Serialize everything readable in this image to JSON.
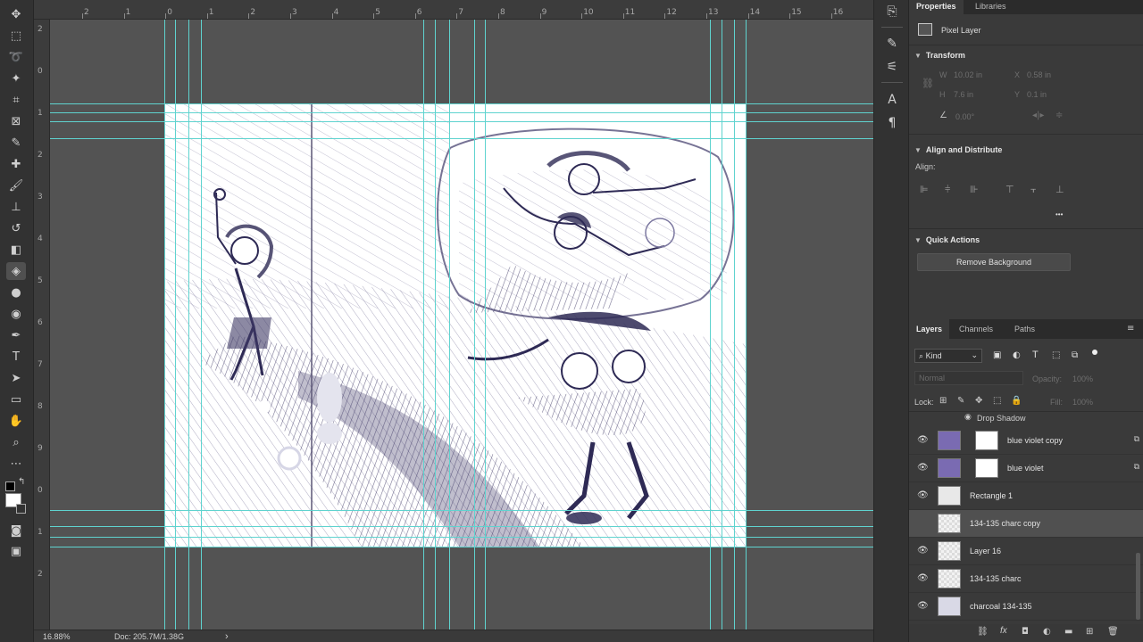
{
  "toolbar": {
    "tools": [
      {
        "icon": "move-icon",
        "glyph": "✥"
      },
      {
        "icon": "marquee-icon",
        "glyph": "⬚"
      },
      {
        "icon": "lasso-icon",
        "glyph": "➰"
      },
      {
        "icon": "magic-wand-icon",
        "glyph": "✦"
      },
      {
        "icon": "crop-icon",
        "glyph": "⌗"
      },
      {
        "icon": "frame-icon",
        "glyph": "⊠"
      },
      {
        "icon": "eyedropper-icon",
        "glyph": "✎"
      },
      {
        "icon": "healing-brush-icon",
        "glyph": "✚"
      },
      {
        "icon": "brush-icon",
        "glyph": "🖌"
      },
      {
        "icon": "clone-stamp-icon",
        "glyph": "⊥"
      },
      {
        "icon": "history-brush-icon",
        "glyph": "↺"
      },
      {
        "icon": "eraser-icon",
        "glyph": "◧"
      },
      {
        "icon": "paint-bucket-icon",
        "glyph": "◈"
      },
      {
        "icon": "blur-icon",
        "glyph": "●"
      },
      {
        "icon": "dodge-icon",
        "glyph": "◉"
      },
      {
        "icon": "pen-icon",
        "glyph": "✒"
      },
      {
        "icon": "type-icon",
        "glyph": "T"
      },
      {
        "icon": "path-selection-icon",
        "glyph": "➤"
      },
      {
        "icon": "rectangle-icon",
        "glyph": "▭"
      },
      {
        "icon": "hand-icon",
        "glyph": "✋"
      },
      {
        "icon": "zoom-icon",
        "glyph": "⌕"
      },
      {
        "icon": "more-tools-icon",
        "glyph": "⋯"
      }
    ],
    "foreground_color": "#000000",
    "background_color": "#ffffff"
  },
  "rulers": {
    "top": [
      "2",
      "1",
      "0",
      "1",
      "2",
      "3",
      "4",
      "5",
      "6",
      "7",
      "8",
      "9",
      "10",
      "11",
      "12",
      "13",
      "14",
      "15",
      "16"
    ],
    "left": [
      "2",
      "0",
      "1",
      "2",
      "3",
      "4",
      "5",
      "6",
      "7",
      "8",
      "9",
      "0",
      "1",
      "2"
    ]
  },
  "status": {
    "zoom": "16.88%",
    "doc_info": "Doc: 205.7M/1.38G",
    "arrow": "›"
  },
  "mid_icons": [
    "history-icon",
    "brush-settings-icon",
    "adjustments-icon",
    "character-icon",
    "paragraph-icon"
  ],
  "properties": {
    "tabs": [
      "Properties",
      "Libraries"
    ],
    "layer_type": "Pixel Layer",
    "transform_heading": "Transform",
    "w_label": "W",
    "w_value": "10.02 in",
    "x_label": "X",
    "x_value": "0.58 in",
    "h_label": "H",
    "h_value": "7.6 in",
    "y_label": "Y",
    "y_value": "0.1 in",
    "angle_value": "0.00°",
    "align_heading": "Align and Distribute",
    "align_label": "Align:",
    "more": "•••",
    "quick_actions_heading": "Quick Actions",
    "remove_bg": "Remove Background"
  },
  "layers_panel": {
    "tabs": [
      "Layers",
      "Channels",
      "Paths"
    ],
    "filter_kind": "Kind",
    "blend_mode": "Normal",
    "opacity_label": "Opacity:",
    "opacity_value": "100%",
    "lock_label": "Lock:",
    "fill_label": "Fill:",
    "fill_value": "100%",
    "drop_shadow": "Drop Shadow",
    "layers": [
      {
        "name": "blue violet copy",
        "visible": true,
        "thumb_color": "#7a6bb2",
        "mask": true,
        "selected": false
      },
      {
        "name": "blue violet",
        "visible": true,
        "thumb_color": "#7a6bb2",
        "mask": true,
        "selected": false
      },
      {
        "name": "Rectangle 1",
        "visible": true,
        "thumb_color": "#e8e8e8",
        "mask": false,
        "selected": false
      },
      {
        "name": "134-135 charc copy",
        "visible": false,
        "thumb_color": "#efefef",
        "mask": false,
        "selected": true
      },
      {
        "name": "Layer 16",
        "visible": true,
        "thumb_color": "#f0f0f0",
        "mask": false,
        "selected": false
      },
      {
        "name": "134-135 charc",
        "visible": true,
        "thumb_color": "#f0f0f0",
        "mask": false,
        "selected": false
      },
      {
        "name": "charcoal 134-135",
        "visible": true,
        "thumb_color": "#d9d9e6",
        "mask": false,
        "selected": false
      }
    ]
  }
}
